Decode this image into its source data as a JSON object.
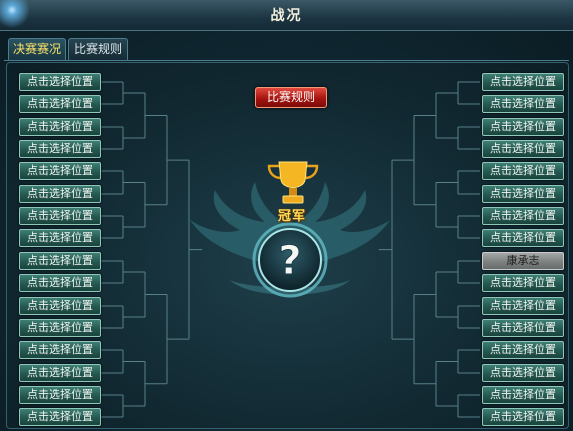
{
  "window": {
    "title": "战况"
  },
  "tabs": [
    {
      "label": "决赛赛况"
    },
    {
      "label": "比赛规则"
    }
  ],
  "rules_button": {
    "label": "比赛规则"
  },
  "champion": {
    "label": "冠军",
    "mystery_symbol": "?"
  },
  "left_slots": [
    "点击选择位置",
    "点击选择位置",
    "点击选择位置",
    "点击选择位置",
    "点击选择位置",
    "点击选择位置",
    "点击选择位置",
    "点击选择位置",
    "点击选择位置",
    "点击选择位置",
    "点击选择位置",
    "点击选择位置",
    "点击选择位置",
    "点击选择位置",
    "点击选择位置",
    "点击选择位置"
  ],
  "right_slots": [
    "点击选择位置",
    "点击选择位置",
    "点击选择位置",
    "点击选择位置",
    "点击选择位置",
    "点击选择位置",
    "点击选择位置",
    "点击选择位置",
    "康承志",
    "点击选择位置",
    "点击选择位置",
    "点击选择位置",
    "点击选择位置",
    "点击选择位置",
    "点击选择位置",
    "点击选择位置"
  ],
  "occupied_slot_color": "#7d8281",
  "empty_slot_color": "#245850"
}
